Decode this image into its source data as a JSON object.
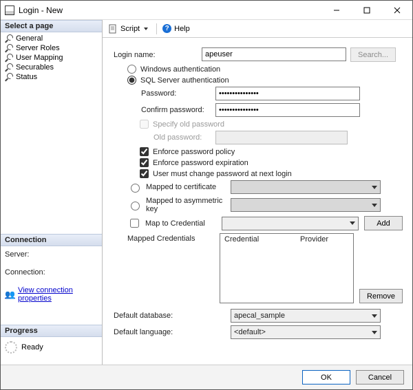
{
  "window": {
    "title": "Login - New"
  },
  "sidebar": {
    "header_pages": "Select a page",
    "items": [
      {
        "label": "General"
      },
      {
        "label": "Server Roles"
      },
      {
        "label": "User Mapping"
      },
      {
        "label": "Securables"
      },
      {
        "label": "Status"
      }
    ],
    "header_connection": "Connection",
    "conn_server_label": "Server:",
    "conn_connection_label": "Connection:",
    "conn_link": "View connection properties",
    "header_progress": "Progress",
    "progress_status": "Ready"
  },
  "toolbar": {
    "script_label": "Script",
    "help_label": "Help"
  },
  "form": {
    "login_name_label": "Login name:",
    "login_name_value": "apeuser",
    "search_btn": "Search...",
    "auth_windows": "Windows authentication",
    "auth_sql": "SQL Server authentication",
    "password_label": "Password:",
    "password_value": "•••••••••••••••",
    "confirm_label": "Confirm password:",
    "confirm_value": "•••••••••••••••",
    "specify_old": "Specify old password",
    "old_password_label": "Old password:",
    "enforce_policy": "Enforce password policy",
    "enforce_expiration": "Enforce password expiration",
    "must_change": "User must change password at next login",
    "mapped_cert": "Mapped to certificate",
    "mapped_asym": "Mapped to asymmetric key",
    "map_credential": "Map to Credential",
    "add_btn": "Add",
    "mapped_credentials_label": "Mapped Credentials",
    "cred_col1": "Credential",
    "cred_col2": "Provider",
    "remove_btn": "Remove",
    "default_db_label": "Default database:",
    "default_db_value": "apecal_sample",
    "default_lang_label": "Default language:",
    "default_lang_value": "<default>"
  },
  "footer": {
    "ok": "OK",
    "cancel": "Cancel"
  }
}
